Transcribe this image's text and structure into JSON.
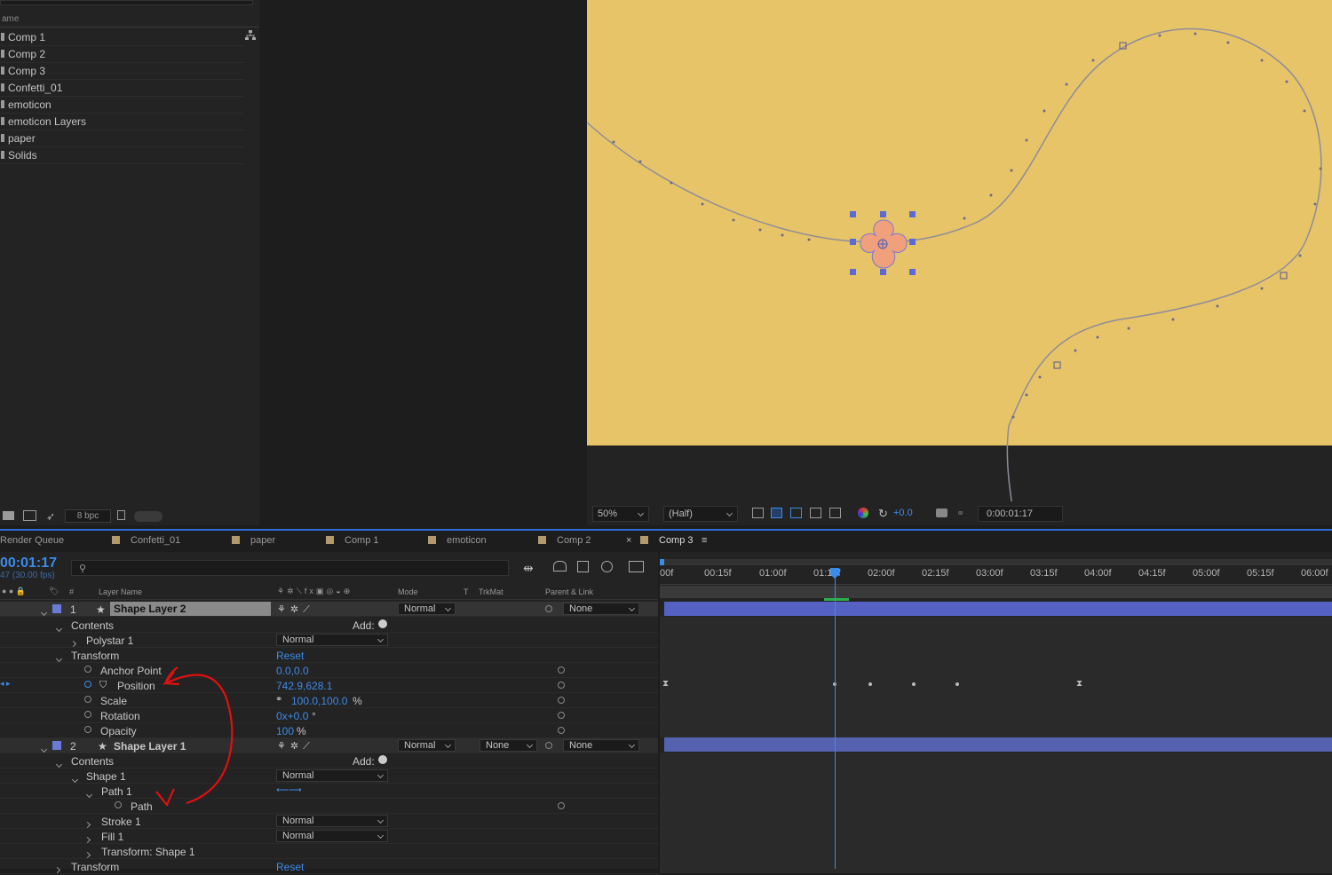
{
  "project": {
    "header": "ame",
    "items": [
      "Comp 1",
      "Comp 2",
      "Comp 3",
      "Confetti_01",
      "emoticon",
      "emoticon Layers",
      "paper",
      "Solids"
    ],
    "bpc": "8 bpc"
  },
  "viewer": {
    "zoom": "50%",
    "resolution": "(Half)",
    "exposure": "+0.0",
    "timecode": "0:00:01:17"
  },
  "tabs": [
    "Render Queue",
    "Confetti_01",
    "paper",
    "Comp 1",
    "emoticon",
    "Comp 2",
    "Comp 3"
  ],
  "timeline": {
    "timecode": "00:01:17",
    "fps": "47 (30.00 fps)",
    "columns": {
      "name": "Layer Name",
      "mode": "Mode",
      "t": "T",
      "trkmat": "TrkMat",
      "parent": "Parent & Link"
    },
    "ruler": [
      "00f",
      "00:15f",
      "01:00f",
      "01:15f",
      "02:00f",
      "02:15f",
      "03:00f",
      "03:15f",
      "04:00f",
      "04:15f",
      "05:00f",
      "05:15f",
      "06:00f"
    ],
    "layer1": {
      "num": "1",
      "name": "Shape Layer 2",
      "mode": "Normal",
      "parent": "None",
      "contents": "Contents",
      "add": "Add:",
      "polystar": "Polystar 1",
      "polystar_mode": "Normal",
      "transform": "Transform",
      "reset": "Reset",
      "props": [
        {
          "name": "Anchor Point",
          "value": "0.0,0.0"
        },
        {
          "name": "Position",
          "value": "742.9,628.1"
        },
        {
          "name": "Scale",
          "value": "100.0,100.0",
          "unit": "%"
        },
        {
          "name": "Rotation",
          "value": "0x+0.0",
          "unit": "°"
        },
        {
          "name": "Opacity",
          "value": "100",
          "unit": "%"
        }
      ]
    },
    "layer2": {
      "num": "2",
      "name": "Shape Layer 1",
      "mode": "Normal",
      "trkmat": "None",
      "parent": "None",
      "contents": "Contents",
      "add": "Add:",
      "shape": "Shape 1",
      "shape_mode": "Normal",
      "path1": "Path 1",
      "path": "Path",
      "stroke": "Stroke 1",
      "stroke_mode": "Normal",
      "fill": "Fill 1",
      "fill_mode": "Normal",
      "transform_shape": "Transform: Shape 1",
      "transform": "Transform",
      "reset": "Reset"
    }
  },
  "colors": {
    "canvas": "#e8c468",
    "accent": "#3d8be8",
    "flower": "#f0a07a",
    "label": "#6a7bd6"
  }
}
